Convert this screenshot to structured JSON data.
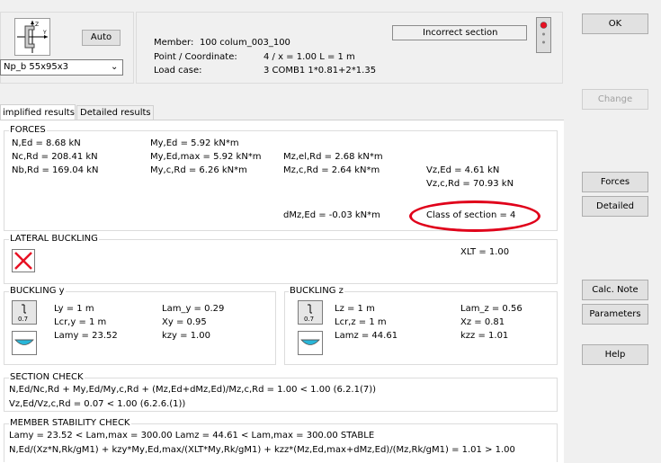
{
  "top": {
    "auto_label": "Auto",
    "profile_value": "Np_b 55x95x3",
    "member_label": "Member:",
    "member_value": "100  colum_003_100",
    "point_label": "Point / Coordinate:",
    "point_value": "4 / x = 1.00 L = 1 m",
    "loadcase_label": "Load case:",
    "loadcase_value": "3 COMB1  1*0.81+2*1.35",
    "status_text": "Incorrect section"
  },
  "side_buttons": {
    "ok": "OK",
    "change": "Change",
    "forces": "Forces",
    "detailed": "Detailed",
    "calc_note": "Calc. Note",
    "parameters": "Parameters",
    "help": "Help"
  },
  "tabs": {
    "simplified": "implified results",
    "detailed": "Detailed results"
  },
  "forces": {
    "title": "FORCES",
    "n_ed": "N,Ed = 8.68 kN",
    "nc_rd": "Nc,Rd = 208.41 kN",
    "nb_rd": "Nb,Rd = 169.04 kN",
    "my_ed": "My,Ed = 5.92 kN*m",
    "my_ed_max": "My,Ed,max = 5.92 kN*m",
    "my_c_rd": "My,c,Rd = 6.26 kN*m",
    "mz_el_rd": "Mz,el,Rd = 2.68 kN*m",
    "mz_c_rd": "Mz,c,Rd = 2.64 kN*m",
    "vz_ed": "Vz,Ed = 4.61 kN",
    "vz_c_rd": "Vz,c,Rd = 70.93 kN",
    "dmz_ed": "dMz,Ed = -0.03 kN*m",
    "class_of_section": "Class of section = 4"
  },
  "lateral": {
    "title": "LATERAL BUCKLING",
    "xlt": "XLT = 1.00"
  },
  "buckling_y": {
    "title": "BUCKLING y",
    "ly": "Ly = 1 m",
    "lcr_y": "Lcr,y = 1 m",
    "lamy": "Lamy = 23.52",
    "lam_y": "Lam_y = 0.29",
    "xy": "Xy = 0.95",
    "kzy": "kzy = 1.00",
    "factor": "0.7"
  },
  "buckling_z": {
    "title": "BUCKLING z",
    "lz": "Lz = 1 m",
    "lcr_z": "Lcr,z = 1 m",
    "lamz": "Lamz = 44.61",
    "lam_z": "Lam_z = 0.56",
    "xz": "Xz = 0.81",
    "kzz": "kzz = 1.01",
    "factor": "0.7"
  },
  "section_check": {
    "title": "SECTION CHECK",
    "line1": "N,Ed/Nc,Rd + My,Ed/My,c,Rd + (Mz,Ed+dMz,Ed)/Mz,c,Rd = 1.00 < 1.00   (6.2.1(7))",
    "line2": "Vz,Ed/Vz,c,Rd = 0.07 < 1.00   (6.2.6.(1))"
  },
  "member_check": {
    "title": "MEMBER STABILITY CHECK",
    "line1": "Lamy = 23.52 < Lam,max = 300.00          Lamz = 44.61 < Lam,max = 300.00    STABLE",
    "line2": "N,Ed/(Xz*N,Rk/gM1) + kzy*My,Ed,max/(XLT*My,Rk/gM1) + kzz*(Mz,Ed,max+dMz,Ed)/(Mz,Rk/gM1) = 1.01 > 1.00"
  },
  "colors": {
    "annotation_red": "#e0001a",
    "cross_red": "#e81123",
    "icon_cyan": "#29b6d8"
  }
}
